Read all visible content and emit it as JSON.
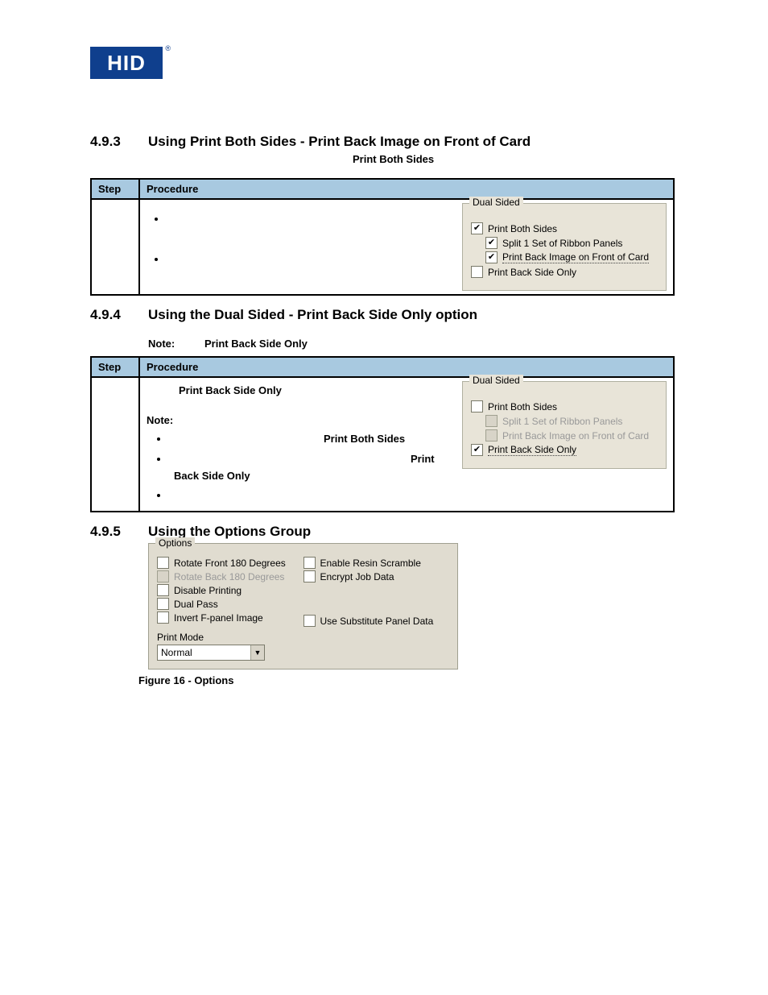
{
  "logo": {
    "text": "HID",
    "reg": "®"
  },
  "section493": {
    "num": "4.9.3",
    "title": "Using Print Both Sides - Print Back Image on Front of Card",
    "sub": "Print Both Sides",
    "th_step": "Step",
    "th_proc": "Procedure",
    "group_legend": "Dual Sided",
    "cb1": "Print Both Sides",
    "cb2": "Split 1 Set of Ribbon Panels",
    "cb3": "Print Back Image on Front of Card",
    "cb4": "Print Back Side Only"
  },
  "section494": {
    "num": "4.9.4",
    "title": "Using the Dual Sided - Print Back Side Only option",
    "note_label": "Note:",
    "note_value": "Print Back Side Only",
    "th_step": "Step",
    "th_proc": "Procedure",
    "body_title": "Print Back Side Only",
    "body_note": "Note:",
    "li1a": "Print Both Sides",
    "li2a": "Print",
    "li2b": "Back Side Only",
    "group_legend": "Dual Sided",
    "cb1": "Print Both Sides",
    "cb2": "Split 1 Set of Ribbon Panels",
    "cb3": "Print Back Image on Front of Card",
    "cb4": "Print Back Side Only"
  },
  "section495": {
    "num": "4.9.5",
    "title": "Using the Options Group",
    "group_legend": "Options",
    "opts_left": {
      "o1": "Rotate Front 180 Degrees",
      "o2": "Rotate Back 180 Degrees",
      "o3": "Disable Printing",
      "o4": "Dual Pass",
      "o5": "Invert F-panel Image"
    },
    "opts_right": {
      "o1": "Enable Resin Scramble",
      "o2": "Encrypt Job Data",
      "o3": "Use Substitute Panel Data"
    },
    "pm_label": "Print Mode",
    "pm_value": "Normal",
    "caption": "Figure 16 - Options"
  }
}
